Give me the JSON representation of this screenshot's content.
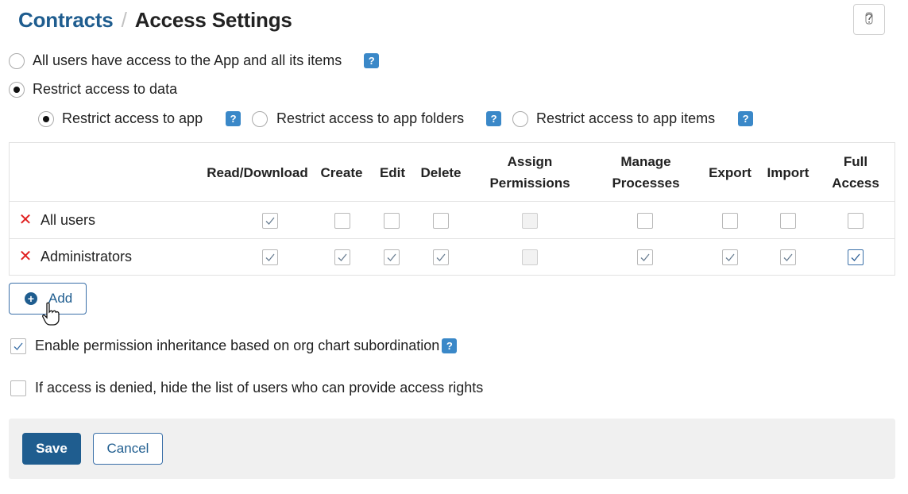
{
  "header": {
    "breadcrumb_app": "Contracts",
    "separator": "/",
    "page_title": "Access Settings",
    "help_icon": "question-icon"
  },
  "access_mode": {
    "options": [
      {
        "label": "All users have access to the App and all its items",
        "selected": false
      },
      {
        "label": "Restrict access to data",
        "selected": true
      }
    ],
    "help_badge": "?"
  },
  "restrict_mode": {
    "options": [
      {
        "label": "Restrict access to app",
        "selected": true
      },
      {
        "label": "Restrict access to app folders",
        "selected": false
      },
      {
        "label": "Restrict access to app items",
        "selected": false
      }
    ]
  },
  "permissions_table": {
    "columns": [
      {
        "line1": "Read/Download",
        "line2": ""
      },
      {
        "line1": "Create",
        "line2": ""
      },
      {
        "line1": "Edit",
        "line2": ""
      },
      {
        "line1": "Delete",
        "line2": ""
      },
      {
        "line1": "Assign",
        "line2": "Permissions"
      },
      {
        "line1": "Manage",
        "line2": "Processes"
      },
      {
        "line1": "Export",
        "line2": ""
      },
      {
        "line1": "Import",
        "line2": ""
      },
      {
        "line1": "Full",
        "line2": "Access"
      }
    ],
    "rows": [
      {
        "name": "All users",
        "checked": [
          true,
          false,
          false,
          false,
          false,
          false,
          false,
          false,
          false
        ],
        "disabled": [
          false,
          false,
          false,
          false,
          true,
          false,
          false,
          false,
          false
        ]
      },
      {
        "name": "Administrators",
        "checked": [
          true,
          true,
          true,
          true,
          false,
          true,
          true,
          true,
          true
        ],
        "disabled": [
          false,
          false,
          false,
          false,
          true,
          false,
          false,
          false,
          false
        ]
      }
    ]
  },
  "add_button": {
    "label": "Add"
  },
  "options": {
    "inheritance": {
      "label": "Enable permission inheritance based on org chart subordination",
      "checked": true
    },
    "hide_users": {
      "label": "If access is denied, hide the list of users who can provide access rights",
      "checked": false
    }
  },
  "footer": {
    "save_label": "Save",
    "cancel_label": "Cancel"
  },
  "colors": {
    "brand": "#1f5d8f",
    "help_badge": "#3a88c8",
    "remove": "#e02020"
  }
}
